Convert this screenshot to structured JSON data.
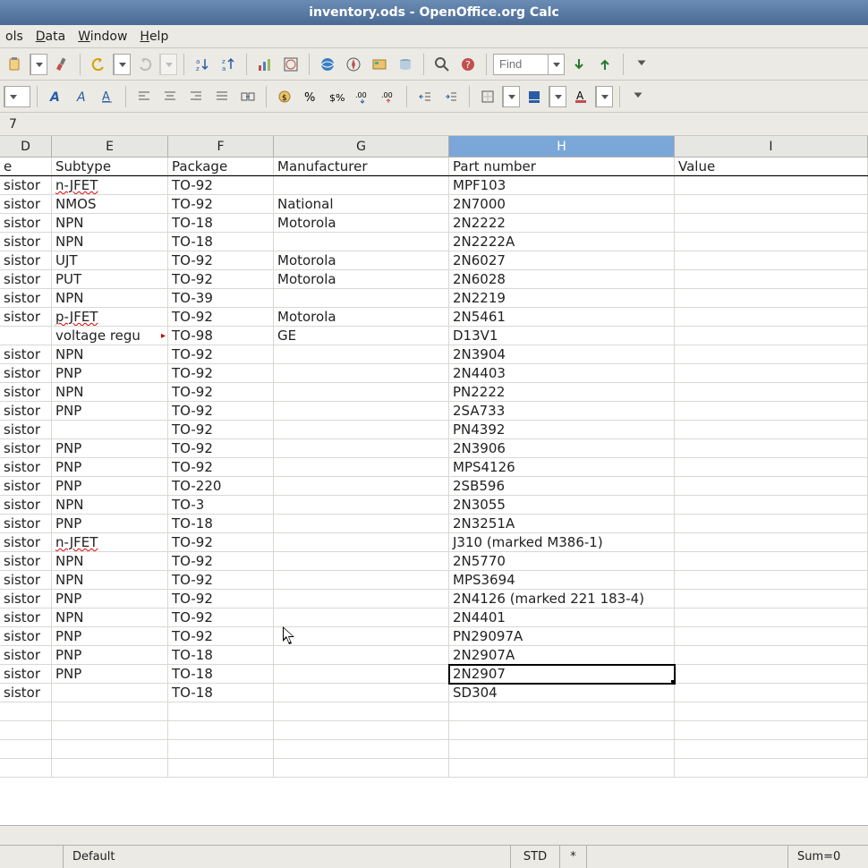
{
  "title": "inventory.ods - OpenOffice.org Calc",
  "menus": {
    "tools": "ols",
    "data": "Data",
    "window": "Window",
    "help": "Help",
    "tools_u": "o",
    "data_u": "D",
    "window_u": "W",
    "help_u": "H"
  },
  "find_placeholder": "Find",
  "formula_value": "7",
  "columns": {
    "D": "D",
    "E": "E",
    "F": "F",
    "G": "G",
    "H": "H",
    "I": "I"
  },
  "headers": {
    "D": "e",
    "E": "Subtype",
    "F": "Package",
    "G": "Manufacturer",
    "H": "Part number",
    "I": "Value"
  },
  "rows": [
    {
      "D": "sistor",
      "E": "n-JFET",
      "E_wave": true,
      "F": "TO-92",
      "G": "",
      "H": "MPF103",
      "I": ""
    },
    {
      "D": "sistor",
      "E": "NMOS",
      "F": "TO-92",
      "G": "National",
      "H": "2N7000",
      "I": ""
    },
    {
      "D": "sistor",
      "E": "NPN",
      "F": "TO-18",
      "G": "Motorola",
      "H": "2N2222",
      "I": ""
    },
    {
      "D": "sistor",
      "E": "NPN",
      "F": "TO-18",
      "G": "",
      "H": "2N2222A",
      "I": ""
    },
    {
      "D": "sistor",
      "E": "UJT",
      "F": "TO-92",
      "G": "Motorola",
      "H": "2N6027",
      "I": ""
    },
    {
      "D": "sistor",
      "E": "PUT",
      "F": "TO-92",
      "G": "Motorola",
      "H": "2N6028",
      "I": ""
    },
    {
      "D": "sistor",
      "E": "NPN",
      "F": "TO-39",
      "G": "",
      "H": "2N2219",
      "I": ""
    },
    {
      "D": "sistor",
      "E": "p-JFET",
      "E_wave": true,
      "F": "TO-92",
      "G": "Motorola",
      "H": "2N5461",
      "I": ""
    },
    {
      "D": "",
      "E": "voltage regu",
      "E_overflow": true,
      "F": "TO-98",
      "G": "GE",
      "H": "D13V1",
      "I": ""
    },
    {
      "D": "sistor",
      "E": "NPN",
      "F": "TO-92",
      "G": "",
      "H": "2N3904",
      "I": ""
    },
    {
      "D": "sistor",
      "E": "PNP",
      "F": "TO-92",
      "G": "",
      "H": "2N4403",
      "I": ""
    },
    {
      "D": "sistor",
      "E": "NPN",
      "F": "TO-92",
      "G": "",
      "H": "PN2222",
      "I": ""
    },
    {
      "D": "sistor",
      "E": "PNP",
      "F": "TO-92",
      "G": "",
      "H": "2SA733",
      "I": ""
    },
    {
      "D": "sistor",
      "E": "",
      "F": "TO-92",
      "G": "",
      "H": "PN4392",
      "I": ""
    },
    {
      "D": "sistor",
      "E": "PNP",
      "F": "TO-92",
      "G": "",
      "H": "2N3906",
      "I": ""
    },
    {
      "D": "sistor",
      "E": "PNP",
      "F": "TO-92",
      "G": "",
      "H": "MPS4126",
      "I": ""
    },
    {
      "D": "sistor",
      "E": "PNP",
      "F": "TO-220",
      "G": "",
      "H": "2SB596",
      "I": ""
    },
    {
      "D": "sistor",
      "E": "NPN",
      "F": "TO-3",
      "G": "",
      "H": "2N3055",
      "I": ""
    },
    {
      "D": "sistor",
      "E": "PNP",
      "F": "TO-18",
      "G": "",
      "H": "2N3251A",
      "I": ""
    },
    {
      "D": "sistor",
      "E": "n-JFET",
      "E_wave": true,
      "F": "TO-92",
      "G": "",
      "H": "J310 (marked M386-1)",
      "I": ""
    },
    {
      "D": "sistor",
      "E": "NPN",
      "F": "TO-92",
      "G": "",
      "H": "2N5770",
      "I": ""
    },
    {
      "D": "sistor",
      "E": "NPN",
      "F": "TO-92",
      "G": "",
      "H": "MPS3694",
      "I": ""
    },
    {
      "D": "sistor",
      "E": "PNP",
      "F": "TO-92",
      "G": "",
      "H": "2N4126 (marked 221 183-4)",
      "I": ""
    },
    {
      "D": "sistor",
      "E": "NPN",
      "F": "TO-92",
      "G": "",
      "H": "2N4401",
      "I": ""
    },
    {
      "D": "sistor",
      "E": "PNP",
      "F": "TO-92",
      "G": "",
      "H": "PN29097A",
      "I": ""
    },
    {
      "D": "sistor",
      "E": "PNP",
      "F": "TO-18",
      "G": "",
      "H": "2N2907A",
      "I": ""
    },
    {
      "D": "sistor",
      "E": "PNP",
      "F": "TO-18",
      "G": "",
      "H": "2N2907",
      "I": "",
      "active": true
    },
    {
      "D": "sistor",
      "E": "",
      "F": "TO-18",
      "G": "",
      "H": "SD304",
      "I": ""
    }
  ],
  "extra_blank_rows": 4,
  "statusbar": {
    "style": "Default",
    "std": "STD",
    "mod": "*",
    "sum": "Sum=0"
  }
}
